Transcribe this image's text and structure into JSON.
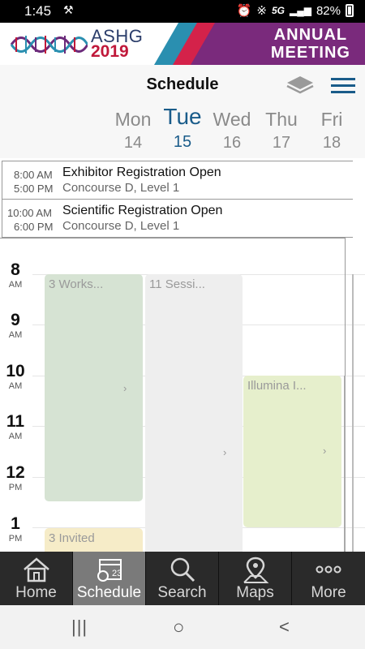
{
  "status": {
    "time": "1:45",
    "network": "5G",
    "battery": "82%"
  },
  "banner": {
    "brand": "ASHG",
    "year": "2019",
    "annual_line1": "ANNUAL",
    "annual_line2": "MEETING"
  },
  "header": {
    "title": "Schedule"
  },
  "days": [
    {
      "name": "Mon",
      "date": "14",
      "selected": false
    },
    {
      "name": "Tue",
      "date": "15",
      "selected": true
    },
    {
      "name": "Wed",
      "date": "16",
      "selected": false
    },
    {
      "name": "Thu",
      "date": "17",
      "selected": false
    },
    {
      "name": "Fri",
      "date": "18",
      "selected": false
    }
  ],
  "all_day_events": [
    {
      "start": "8:00 AM",
      "end": "5:00 PM",
      "title": "Exhibitor Registration Open",
      "location": "Concourse D, Level 1"
    },
    {
      "start": "10:00 AM",
      "end": "6:00 PM",
      "title": "Scientific Registration Open",
      "location": "Concourse D, Level 1"
    }
  ],
  "hours": [
    {
      "h": "8",
      "ap": "AM"
    },
    {
      "h": "9",
      "ap": "AM"
    },
    {
      "h": "10",
      "ap": "AM"
    },
    {
      "h": "11",
      "ap": "AM"
    },
    {
      "h": "12",
      "ap": "PM"
    },
    {
      "h": "1",
      "ap": "PM"
    }
  ],
  "blocks": [
    {
      "label": "3 Works...",
      "color": "#d6e3d3"
    },
    {
      "label": "11 Sessi...",
      "color": "#eeeeee"
    },
    {
      "label": "Illumina I...",
      "color": "#e6efcc"
    },
    {
      "label": "3 Invited",
      "color": "#f6ecc8"
    }
  ],
  "tabs": [
    {
      "label": "Home",
      "icon": "home-icon"
    },
    {
      "label": "Schedule",
      "icon": "calendar-icon",
      "badge": "23",
      "selected": true
    },
    {
      "label": "Search",
      "icon": "search-icon"
    },
    {
      "label": "Maps",
      "icon": "map-pin-icon"
    },
    {
      "label": "More",
      "icon": "more-dots-icon"
    }
  ],
  "nav_buttons": {
    "recent": "|||",
    "home": "○",
    "back": "<"
  }
}
